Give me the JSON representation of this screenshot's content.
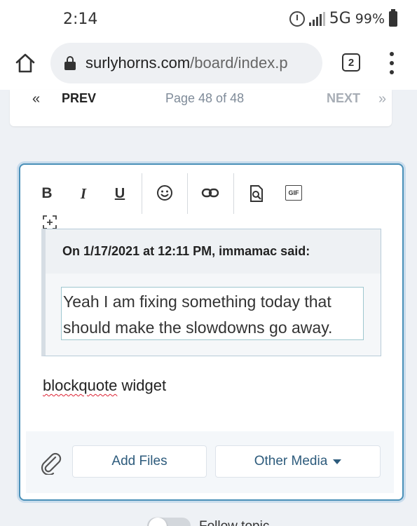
{
  "status_bar": {
    "time": "2:14",
    "network": "5G",
    "battery": "99%",
    "icons": [
      "alarm-icon",
      "signal-icon",
      "battery-icon"
    ]
  },
  "browser": {
    "url_host": "surlyhorns.com",
    "url_path": "/board/index.p",
    "tab_count": "2",
    "icons": [
      "home-icon",
      "lock-icon",
      "tabs-icon",
      "menu-icon"
    ]
  },
  "pagination": {
    "prev_arrow": "«",
    "prev_label": "PREV",
    "page_text": "Page 48 of 48",
    "next_label": "NEXT",
    "next_arrow": "»"
  },
  "toolbar": {
    "bold": "B",
    "italic": "I",
    "underline": "U",
    "gif": "GIF",
    "icons": [
      "emoji-icon",
      "link-icon",
      "preview-icon",
      "gif-icon",
      "expand-icon"
    ]
  },
  "quote": {
    "header": "On 1/17/2021 at 12:11 PM, immamac said:",
    "line1": "Yeah I am fixing something today that",
    "line2": "should make the slowdowns go away."
  },
  "editor": {
    "word1": "blockquote",
    "word2": " widget"
  },
  "attachments": {
    "add_files": "Add Files",
    "other_media": "Other Media"
  },
  "follow": {
    "label": "Follow topic"
  },
  "colors": {
    "accent": "#4a90b8",
    "link": "#2d5b7c",
    "muted": "#a7adb5"
  }
}
